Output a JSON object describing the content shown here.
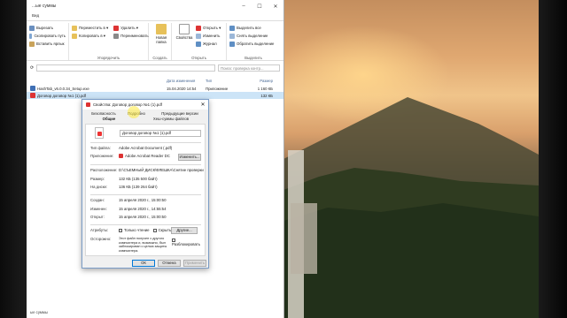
{
  "explorer": {
    "title": "...ые суммы",
    "ribbon_tabs": [
      "Вид"
    ],
    "groups": {
      "clipboard": {
        "items": [
          "Вырезать",
          "Скопировать путь",
          "Вставить ярлык"
        ]
      },
      "organize": {
        "label": "Упорядочить",
        "items": [
          "Переместить в ▾",
          "Копировать в ▾",
          "Удалить ▾",
          "Переименовать"
        ]
      },
      "create": {
        "label": "Создать",
        "items": [
          "Новая папка"
        ]
      },
      "open": {
        "label": "Открыть",
        "big": "Свойства",
        "items": [
          "Открыть ▾",
          "Изменить",
          "Журнал"
        ]
      },
      "select": {
        "label": "Выделить",
        "items": [
          "Выделить все",
          "Снять выделение",
          "Обратить выделение"
        ]
      }
    },
    "search_placeholder": "Поиск: проверка контр...",
    "columns": [
      "Дата изменения",
      "Тип",
      "Размер"
    ],
    "files": [
      {
        "name": "HashTab_v6.0.0.34_Setup.exe",
        "date": "15.04.2020 14:54",
        "type": "Приложение",
        "size": "1 160 КБ"
      },
      {
        "name": "Договор договор №1 (1).pdf",
        "date": "",
        "type": "",
        "size": "132 КБ"
      }
    ],
    "status": "ые суммы"
  },
  "dialog": {
    "title": "Свойства: Договор договор №1 (1).pdf",
    "tabs": {
      "security": "Безопасность",
      "general": "Общие",
      "details": "Подробно",
      "previous": "Предыдущие версии",
      "hash": "Хеш-суммы файлов"
    },
    "filename": "Договор договор №1 (1).pdf",
    "labels": {
      "file_type": "Тип файла:",
      "app": "Приложение:",
      "location": "Расположение:",
      "size": "Размер:",
      "on_disk": "На диске:",
      "created": "Создан:",
      "modified": "Изменен:",
      "opened": "Открыт:",
      "attributes": "Атрибуты:",
      "caution": "Осторожно:"
    },
    "values": {
      "file_type": "Adobe Acrobat Document (.pdf)",
      "app": "Adobe Acrobat Reader DC",
      "location": "D:\\СЪЕМНЫЙ ДИСК\\ФЛЕШКА\\Снятие проверки",
      "size": "132 КБ (135 500 байт)",
      "on_disk": "136 КБ (139 264 байт)",
      "created": "15 апреля 2020 г., 15:00:50",
      "modified": "15 апреля 2020 г., 14:55:54",
      "opened": "15 апреля 2020 г., 15:00:50",
      "caution": "Этот файл получен с другого компьютера и, возможно, был заблокирован с целью защиты компьютера."
    },
    "change_button": "Изменить...",
    "readonly": "Только чтение",
    "hidden": "Скрытый",
    "other": "Другие...",
    "unblock": "Разблокировать",
    "buttons": {
      "ok": "ОК",
      "cancel": "Отмена",
      "apply": "Применить"
    }
  }
}
